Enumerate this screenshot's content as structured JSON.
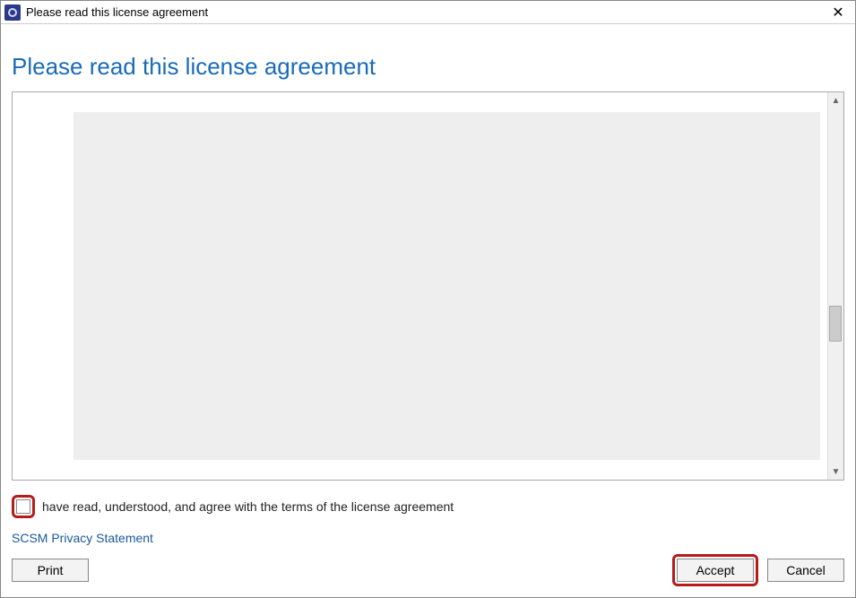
{
  "titlebar": {
    "title": "Please read this license agreement"
  },
  "heading": "Please read this license agreement",
  "checkbox_label": "have read, understood, and agree with the terms of the license agreement",
  "privacy_link": "SCSM Privacy Statement",
  "buttons": {
    "print": "Print",
    "accept": "Accept",
    "cancel": "Cancel"
  }
}
